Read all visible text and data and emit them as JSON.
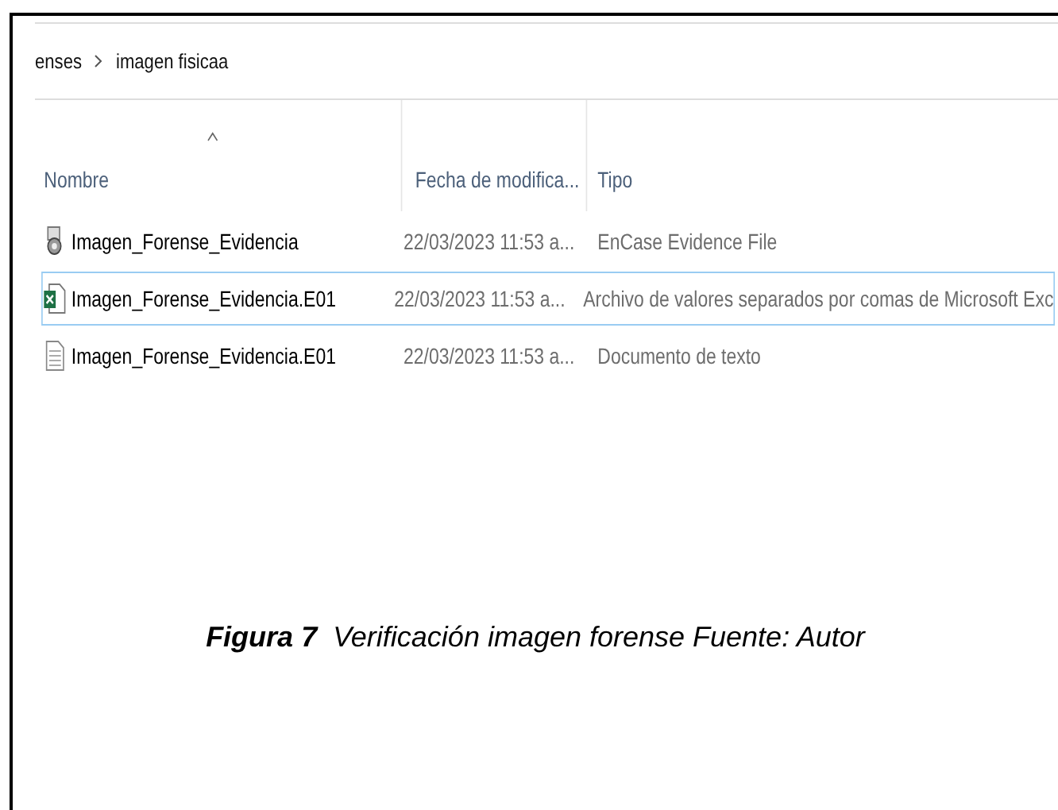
{
  "breadcrumb": {
    "items": [
      "enses",
      "imagen fisicaa"
    ]
  },
  "table": {
    "columns": [
      {
        "label": "Nombre",
        "sorted": true
      },
      {
        "label": "Fecha de modifica...",
        "sorted": false
      },
      {
        "label": "Tipo",
        "sorted": false
      }
    ],
    "rows": [
      {
        "kind": "evidence",
        "name": "Imagen_Forense_Evidencia",
        "date": "22/03/2023 11:53 a...",
        "type": "EnCase Evidence File",
        "selected": false
      },
      {
        "kind": "excel",
        "name": "Imagen_Forense_Evidencia.E01",
        "date": "22/03/2023 11:53 a...",
        "type": "Archivo de valores separados por comas de Microsoft Exc",
        "selected": true
      },
      {
        "kind": "text",
        "name": "Imagen_Forense_Evidencia.E01",
        "date": "22/03/2023 11:53 a...",
        "type": "Documento de texto",
        "selected": false
      }
    ]
  },
  "caption": "**Figura 7**  Verificación imagen forense Fuente: Autor"
}
